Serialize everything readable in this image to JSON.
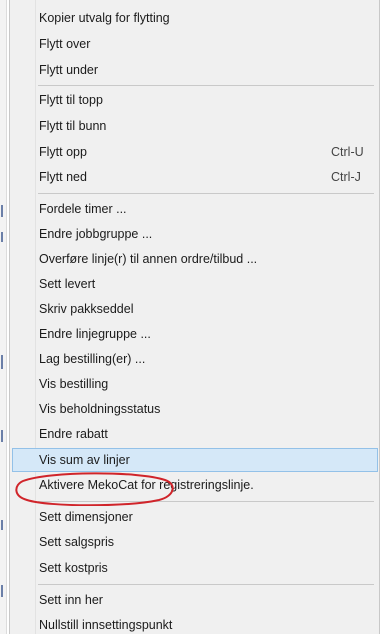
{
  "menu": {
    "items": [
      {
        "label": "Kopier utvalg for flytting",
        "shortcut": ""
      },
      {
        "label": "Flytt over",
        "shortcut": ""
      },
      {
        "label": "Flytt under",
        "shortcut": ""
      },
      {
        "label": "Flytt til topp",
        "shortcut": ""
      },
      {
        "label": "Flytt til bunn",
        "shortcut": ""
      },
      {
        "label": "Flytt opp",
        "shortcut": "Ctrl-U"
      },
      {
        "label": "Flytt ned",
        "shortcut": "Ctrl-J"
      },
      {
        "label": "Fordele timer ...",
        "shortcut": ""
      },
      {
        "label": "Endre jobbgruppe ...",
        "shortcut": ""
      },
      {
        "label": "Overføre linje(r) til annen ordre/tilbud ...",
        "shortcut": ""
      },
      {
        "label": "Sett levert",
        "shortcut": ""
      },
      {
        "label": "Skriv pakkseddel",
        "shortcut": ""
      },
      {
        "label": "Endre linjegruppe ...",
        "shortcut": ""
      },
      {
        "label": "Lag bestilling(er) ...",
        "shortcut": ""
      },
      {
        "label": "Vis bestilling",
        "shortcut": ""
      },
      {
        "label": "Vis beholdningsstatus",
        "shortcut": ""
      },
      {
        "label": "Endre rabatt",
        "shortcut": ""
      },
      {
        "label": "Vis sum av linjer",
        "shortcut": "",
        "selected": true
      },
      {
        "label": "Aktivere MekoCat for registreringslinje.",
        "shortcut": ""
      },
      {
        "label": "Sett dimensjoner",
        "shortcut": ""
      },
      {
        "label": "Sett salgspris",
        "shortcut": ""
      },
      {
        "label": "Sett kostpris",
        "shortcut": ""
      },
      {
        "label": "Sett inn her",
        "shortcut": ""
      },
      {
        "label": "Nullstill innsettingspunkt",
        "shortcut": ""
      }
    ]
  },
  "colors": {
    "menu_background": "#f0f0f0",
    "selected_background": "#d5e8f8",
    "selected_border": "#93c1e8",
    "annotation_ellipse": "#d0242a"
  }
}
